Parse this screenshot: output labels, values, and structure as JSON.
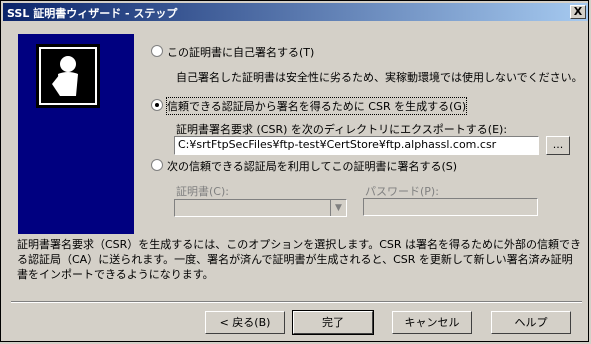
{
  "window": {
    "title": "SSL 証明書ウィザード - ステップ",
    "close_label": "X"
  },
  "options": {
    "self_signed": {
      "label": "この証明書に自己署名する(T)",
      "note": "自己署名した証明書は安全性に劣るため、実稼動環境では使用しないでください。"
    },
    "generate_csr": {
      "label": "信頼できる認証局から署名を得るために CSR を生成する(G)",
      "export_label": "証明書署名要求 (CSR) を次のディレクトリにエクスポートする(E):",
      "export_path": "C:¥srtFtpSecFiles¥ftp-test¥CertStore¥ftp.alphassl.com.csr",
      "browse_label": "..."
    },
    "use_ca": {
      "label": "次の信頼できる認証局を利用してこの証明書に署名する(S)",
      "cert_label": "証明書(C):",
      "password_label": "パスワード(P):"
    }
  },
  "description": "証明書署名要求（CSR）を生成するには、このオプションを選択します。CSR は署名を得るために外部の信頼できる認証局（CA）に送られます。一度、署名が済んで証明書が生成されると、CSR を更新して新しい署名済み証明書をインポートできるようになります。",
  "buttons": {
    "back": "< 戻る(B)",
    "finish": "完了",
    "cancel": "キャンセル",
    "help": "ヘルプ"
  }
}
